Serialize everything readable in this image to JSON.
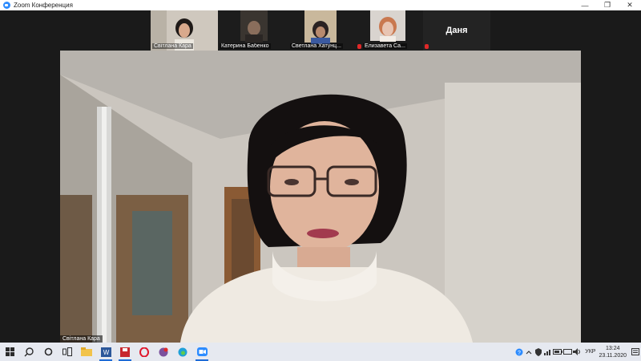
{
  "window": {
    "title": "Zoom Конференция",
    "controls": {
      "minimize": "—",
      "restore": "❐",
      "close": "✕"
    }
  },
  "gallery": [
    {
      "name": "Світлана Кара",
      "active": true,
      "muted": false,
      "video": true
    },
    {
      "name": "Катерина Бабенко",
      "active": false,
      "muted": false,
      "video": true
    },
    {
      "name": "Светлана Хатунц...",
      "active": false,
      "muted": false,
      "video": true
    },
    {
      "name": "Елизавета Са...",
      "active": false,
      "muted": true,
      "video": true
    },
    {
      "name": "Даня",
      "active": false,
      "muted": true,
      "video": false
    }
  ],
  "main": {
    "speaker_name": "Світлана Кара"
  },
  "taskbar": {
    "apps": [
      "start-icon",
      "search-icon",
      "cortana-icon",
      "task-view-icon",
      "file-explorer-icon",
      "word-icon",
      "save-icon",
      "opera-icon",
      "viber-icon",
      "edge-icon",
      "zoom-icon"
    ],
    "language": "УКР",
    "time": "13:24",
    "date": "23.11.2020"
  },
  "colors": {
    "accent": "#2d8cff",
    "active_speaker": "#f5d140",
    "taskbar": "#e6e9f0"
  }
}
